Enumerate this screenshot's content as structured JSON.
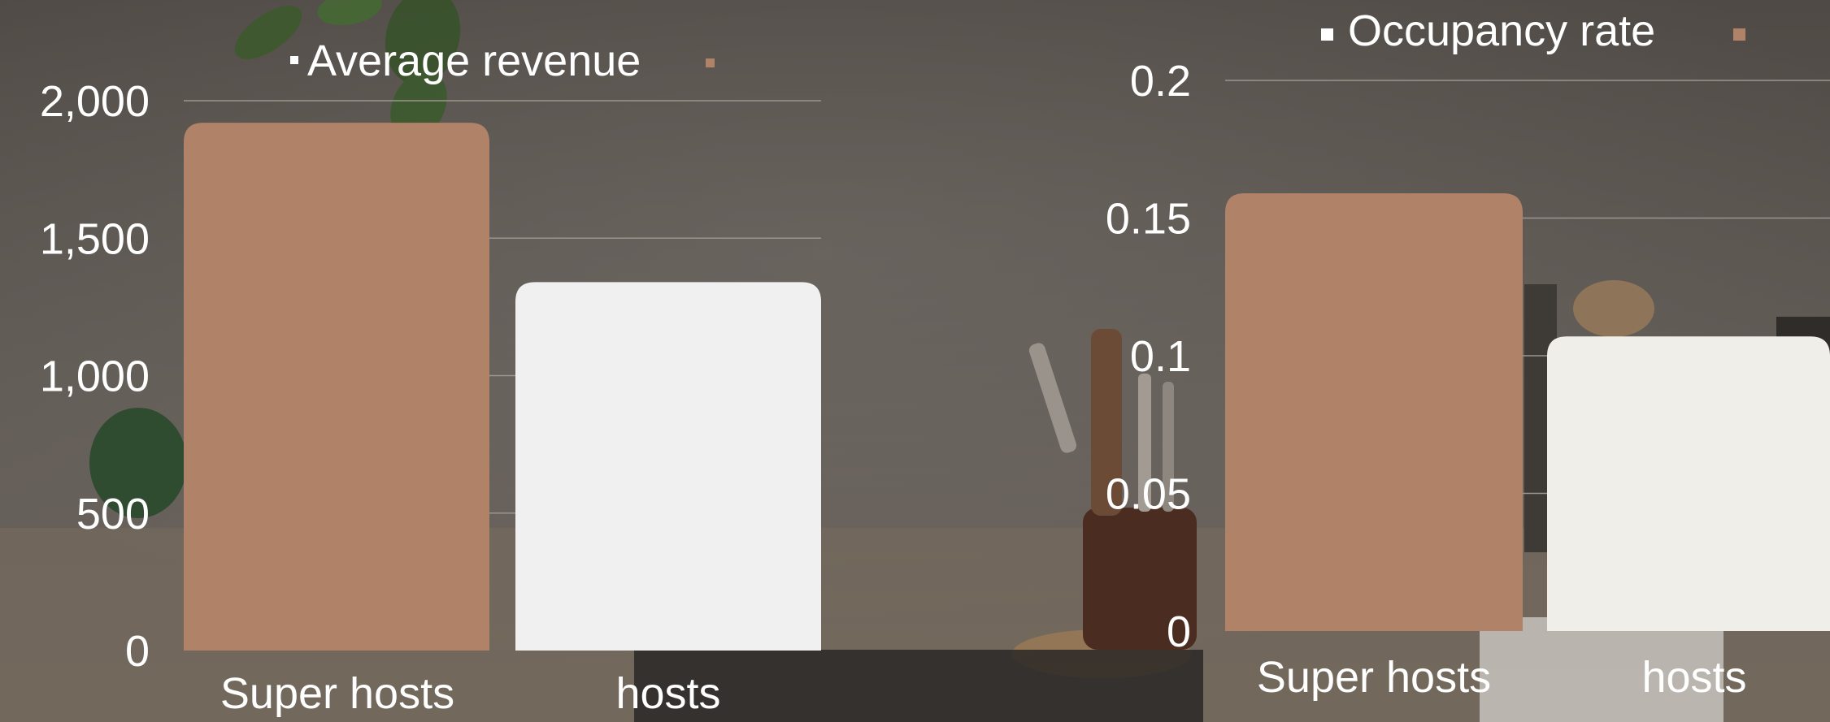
{
  "colors": {
    "super_hosts": "#b08267",
    "hosts": "#f0f0f0",
    "hosts_alt": "#efeee9",
    "gridline": "#9a958f",
    "text": "#ffffff"
  },
  "chart_data": [
    {
      "type": "bar",
      "title": "",
      "legend": [
        {
          "label": "Average revenue",
          "marker_color": "#ffffff"
        },
        {
          "label": "",
          "marker_color": "#b08267"
        }
      ],
      "categories": [
        "Super hosts",
        "hosts"
      ],
      "values": [
        1920,
        1340
      ],
      "bar_colors": [
        "#b08267",
        "#f0f0f0"
      ],
      "ylim": [
        0,
        2000
      ],
      "yticks": [
        0,
        500,
        1000,
        1500,
        2000
      ],
      "ytick_labels": [
        "0",
        "500",
        "1,000",
        "1,500",
        "2,000"
      ],
      "grid": true,
      "legend_position": "top"
    },
    {
      "type": "bar",
      "title": "",
      "legend": [
        {
          "label": "Occupancy rate",
          "marker_color": "#ffffff"
        },
        {
          "label": "",
          "marker_color": "#b08267"
        }
      ],
      "categories": [
        "Super hosts",
        "hosts"
      ],
      "values": [
        0.159,
        0.107
      ],
      "bar_colors": [
        "#b08267",
        "#efeee9"
      ],
      "ylim": [
        0,
        0.2
      ],
      "yticks": [
        0,
        0.05,
        0.1,
        0.15,
        0.2
      ],
      "ytick_labels": [
        "0",
        "0.05",
        "0.1",
        "0.15",
        "0.2"
      ],
      "grid": true,
      "legend_position": "top"
    }
  ]
}
